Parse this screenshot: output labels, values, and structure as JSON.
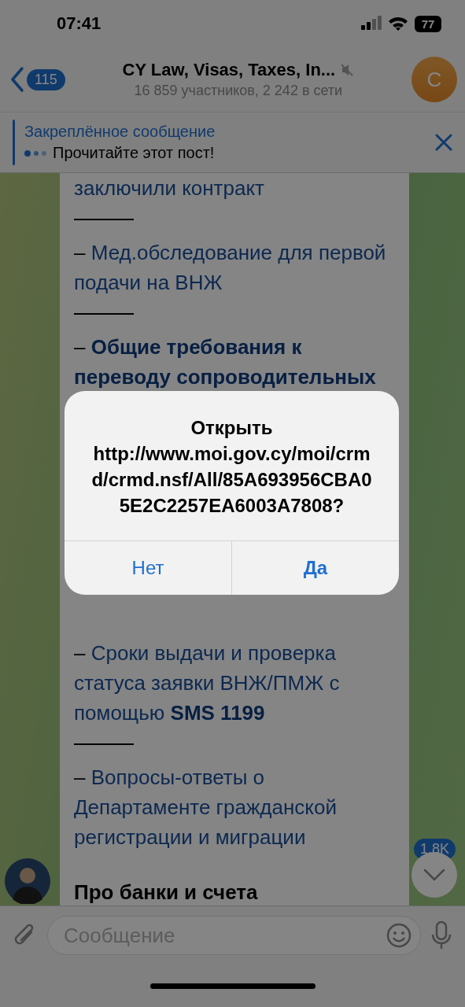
{
  "status_bar": {
    "time": "07:41",
    "battery": "77"
  },
  "header": {
    "back_count": "115",
    "title": "CY Law, Visas, Taxes, In...",
    "muted": true,
    "subtitle": "16 859 участников, 2 242 в сети",
    "avatar_letter": "C"
  },
  "pinned": {
    "title": "Закреплённое сообщение",
    "text": "Прочитайте этот пост!"
  },
  "message": {
    "top_items": [
      {
        "kind": "link",
        "text": "заключили контракт"
      },
      {
        "kind": "rule"
      },
      {
        "kind": "link",
        "prefix": "–",
        "text": "Мед.обследование для первой подачи на ВНЖ"
      },
      {
        "kind": "rule"
      },
      {
        "kind": "link",
        "prefix": "–",
        "text": "**Общие требования к переводу сопроводительных**"
      }
    ],
    "bottom_items": [
      {
        "kind": "link",
        "prefix": "–",
        "text": "Сроки выдачи и проверка статуса заявки ВНЖ/ПМЖ с помощью **SMS 1199**"
      },
      {
        "kind": "rule"
      },
      {
        "kind": "link",
        "prefix": "–",
        "text": "Вопросы-ответы о Департаменте гражданской регистрации и миграции"
      },
      {
        "kind": "heading",
        "text": "**Про банки и счета**"
      }
    ]
  },
  "scroll_down": {
    "badge": "1,8K"
  },
  "input": {
    "placeholder": "Сообщение"
  },
  "alert": {
    "message": "Открыть http://www.moi.gov.cy/moi/crmd/crmd.nsf/All/85A693956CBA05E2C2257EA6003A7808?",
    "buttons": [
      {
        "label": "Нет",
        "kind": "cancel"
      },
      {
        "label": "Да",
        "kind": "default"
      }
    ]
  }
}
